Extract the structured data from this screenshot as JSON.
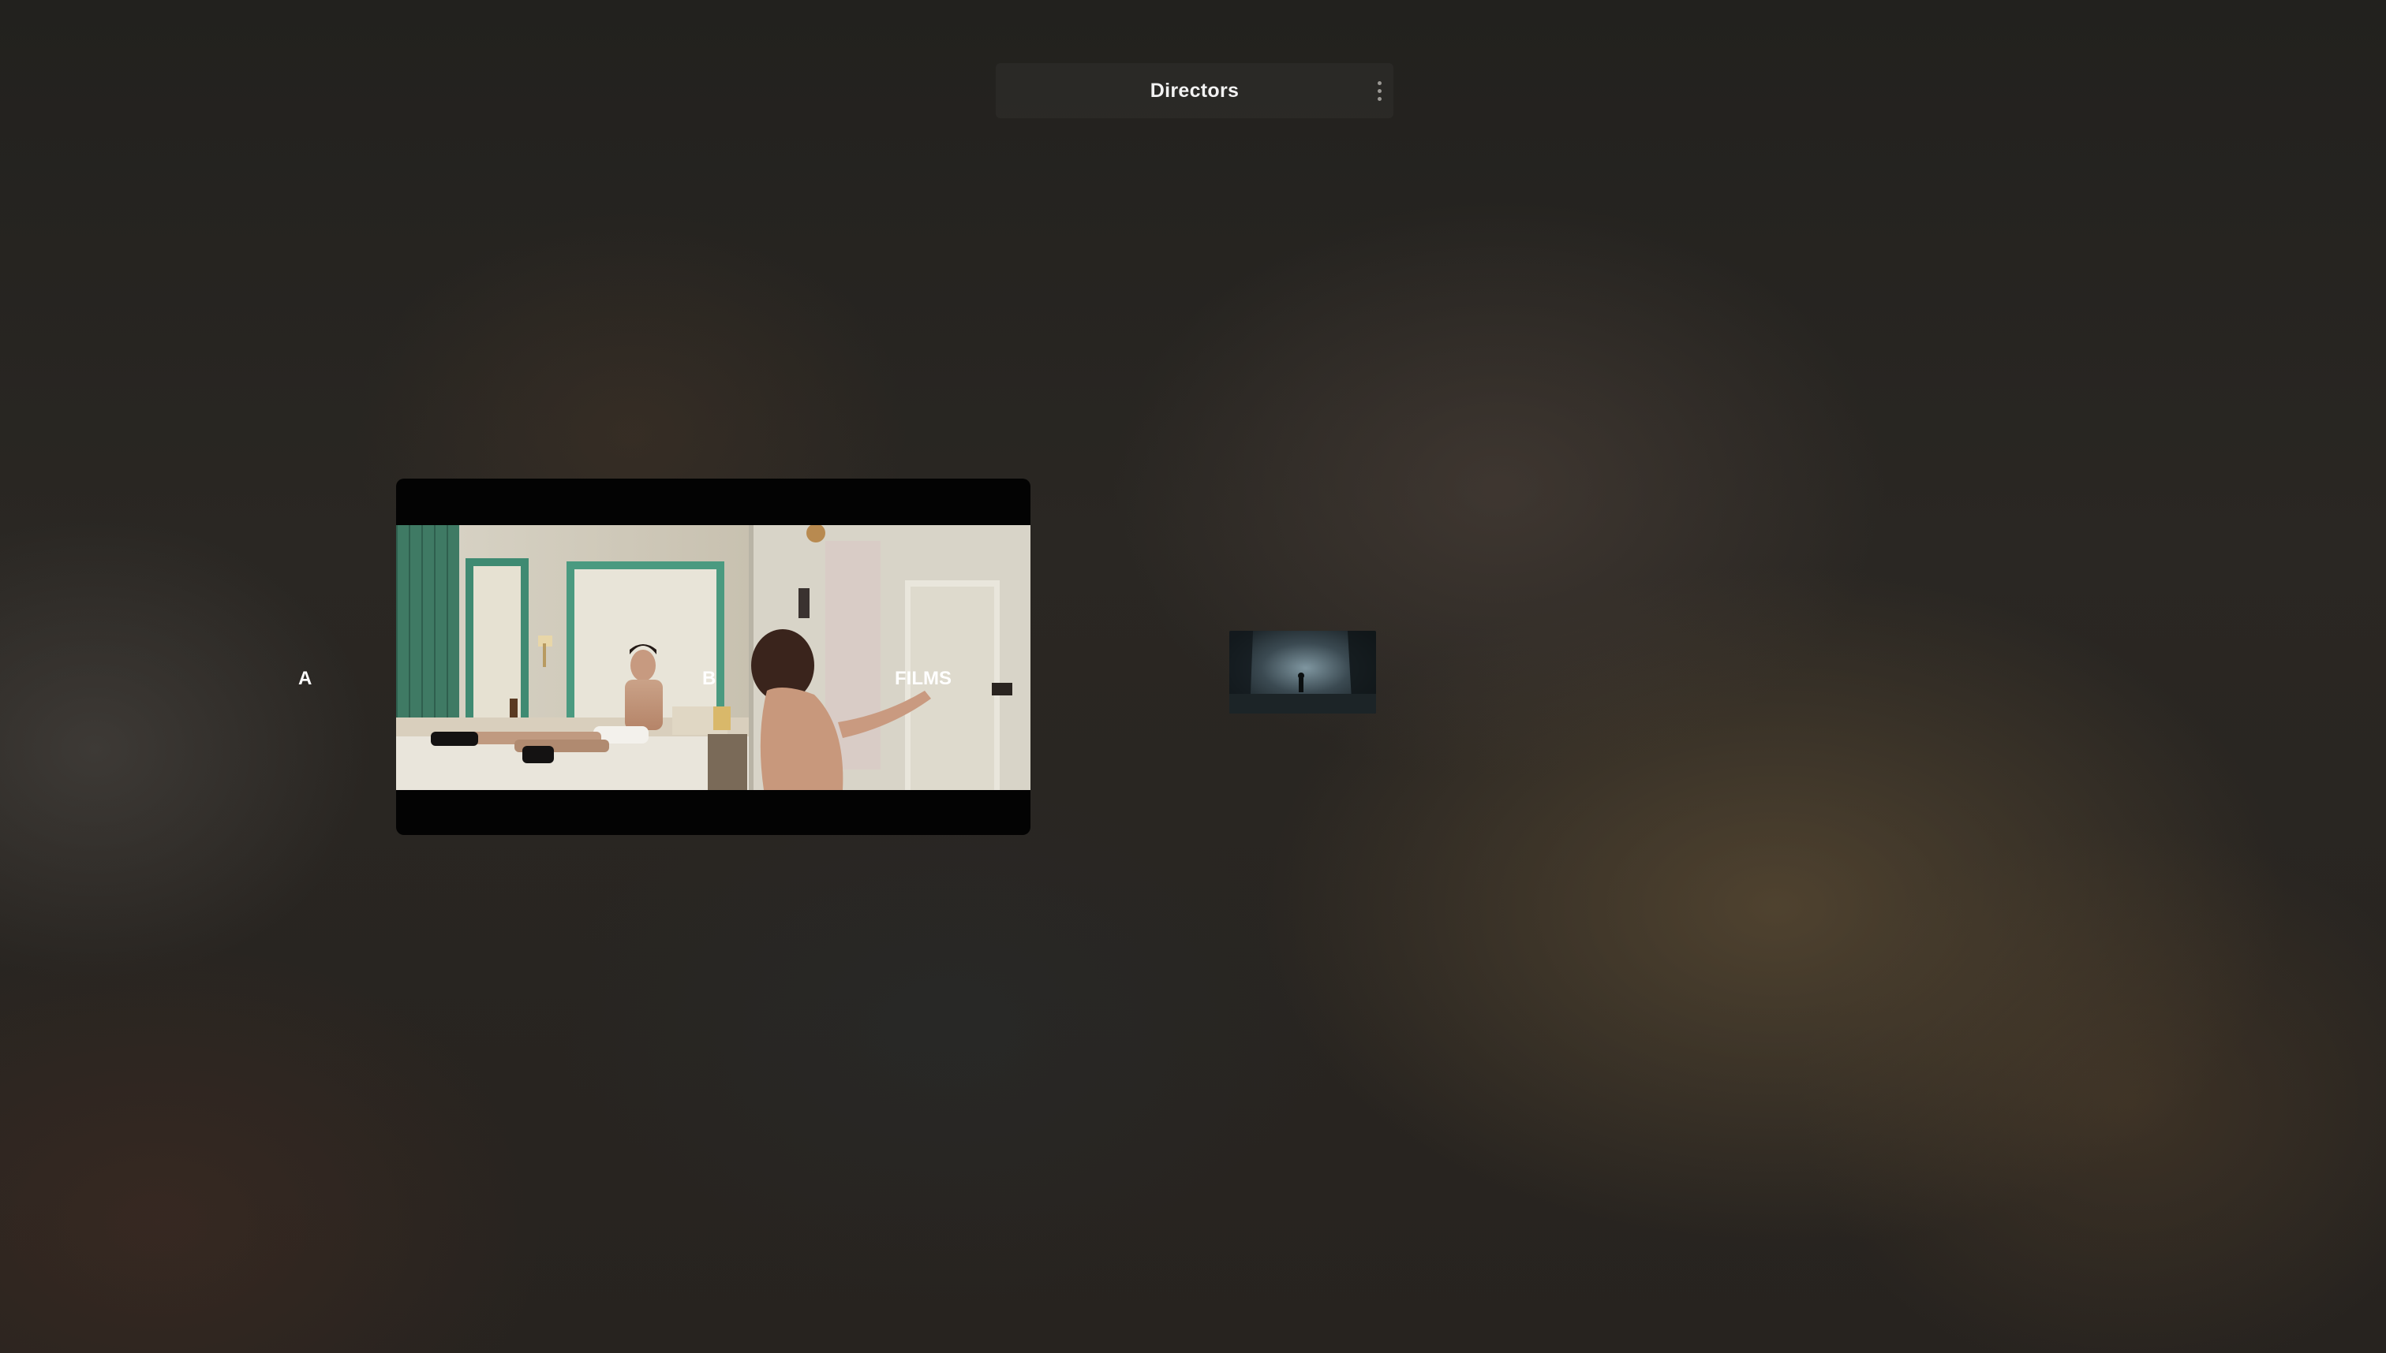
{
  "header": {
    "title": "Directors"
  },
  "labels": {
    "a": "A",
    "b": "B",
    "films": "FILMS"
  },
  "icons": {
    "menu": "more-vertical-icon"
  },
  "media": {
    "main_video": "bedroom-scene-still",
    "side_thumbnail": "forest-night-scene-still"
  },
  "colors": {
    "background": "#262420",
    "text": "#ffffff",
    "player": "#030303"
  }
}
